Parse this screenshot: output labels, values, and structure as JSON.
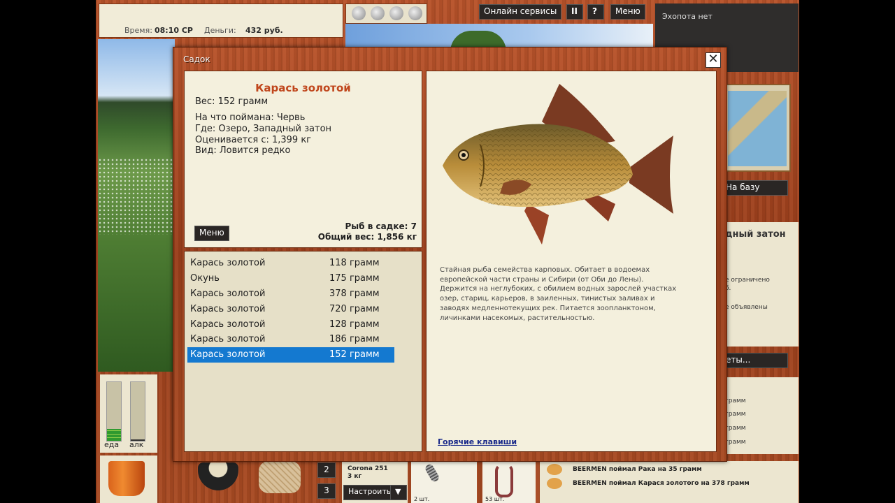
{
  "hud": {
    "time_label": "Время:",
    "time_value": "08:10 СР",
    "money_label": "Деньги:",
    "money_value": "432 руб.",
    "online_button": "Онлайн сервисы",
    "pause_glyph": "II",
    "help_glyph": "?",
    "menu_button": "Меню",
    "echo_text": "Эхопота нет"
  },
  "right_panel": {
    "to_base": "На базу",
    "location_partial": "дный затон",
    "text_line1": "е ограничено",
    "text_line2": "б.",
    "text_line3": "е объявлены",
    "tournaments_partial": "еты...",
    "gram_list": [
      "грамм",
      "грамм",
      "грамм",
      "грамм"
    ]
  },
  "meters": {
    "food": "еда",
    "alcohol": "алк",
    "food_level": 0.2,
    "alcohol_level": 0.02
  },
  "bottom": {
    "slot2": "2",
    "slot3": "3",
    "reel_name": "Corona 251",
    "reel_weight": "3 кг",
    "configure": "Настроить",
    "dropdown_glyph": "▼",
    "bait1_count": "2 шт.",
    "bait2_count": "53 шт.",
    "chat": [
      "BEERMEN поймал Рака на 35 грамм",
      "BEERMEN поймал Карася золотого на 378 грамм"
    ]
  },
  "modal": {
    "title": "Садок",
    "close_glyph": "✕",
    "fish_name": "Карась золотой",
    "weight_line": "Вес: 152 грамм",
    "caught_on": "На что поймана: Червь",
    "where": "Где: Озеро, Западный затон",
    "value": "Оценивается с: 1,399 кг",
    "kind": "Вид: Ловится редко",
    "menu_button": "Меню",
    "fish_count": "Рыб в садке: 7",
    "total_weight": "Общий вес: 1,856 кг",
    "fish_list": [
      {
        "name": "Карась золотой",
        "weight": "118 грамм"
      },
      {
        "name": "Окунь",
        "weight": "175 грамм"
      },
      {
        "name": "Карась золотой",
        "weight": "378 грамм"
      },
      {
        "name": "Карась золотой",
        "weight": "720 грамм"
      },
      {
        "name": "Карась золотой",
        "weight": "128 грамм"
      },
      {
        "name": "Карась золотой",
        "weight": "186 грамм"
      },
      {
        "name": "Карась золотой",
        "weight": "152 грамм"
      }
    ],
    "selected_index": 6,
    "description": "Стайная рыба семейства карповых. Обитает в водоемах европейской части страны и Сибири (от Оби до Лены). Держится на неглубоких, с обилием водных зарослей участках озер, стариц, карьеров, в заиленных, тинистых заливах и заводях медленнотекущих рек.  Питается зоопланктоном, личинками насекомых, растительностью.",
    "hotkeys_link": "Горячие клавиши"
  },
  "colors": {
    "accent": "#b0451e",
    "selection": "#1479d0",
    "fish_title": "#c0461c"
  }
}
